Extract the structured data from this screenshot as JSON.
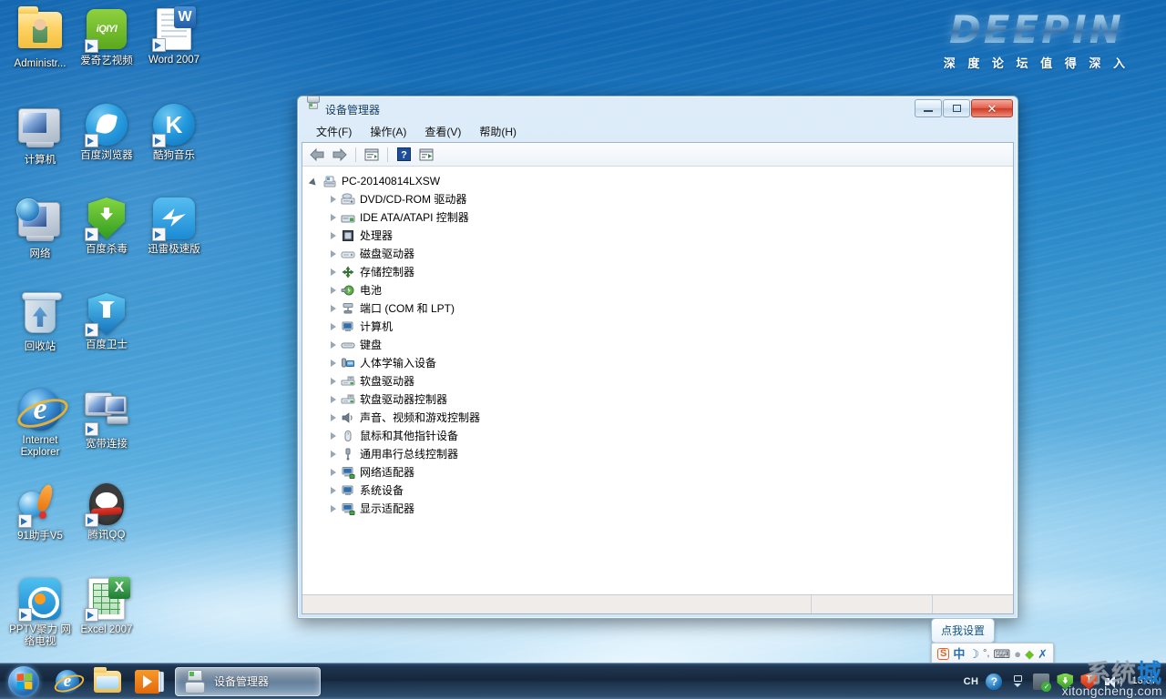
{
  "desktop": {
    "logo": {
      "word": "DEEPIN",
      "tagline": "深 度 论 坛   值 得 深 入"
    },
    "icons": [
      {
        "label": "Administr...",
        "icon": "user-folder-icon",
        "shortcut": false,
        "col": 0,
        "row": 0
      },
      {
        "label": "爱奇艺视频",
        "icon": "iqiyi-icon",
        "shortcut": true,
        "col": 1,
        "row": 0
      },
      {
        "label": "Word 2007",
        "icon": "word-icon",
        "shortcut": true,
        "col": 2,
        "row": 0
      },
      {
        "label": "计算机",
        "icon": "computer-icon",
        "shortcut": false,
        "col": 0,
        "row": 1
      },
      {
        "label": "百度浏览器",
        "icon": "baidu-browser-icon",
        "shortcut": true,
        "col": 1,
        "row": 1
      },
      {
        "label": "酷狗音乐",
        "icon": "kugou-music-icon",
        "shortcut": true,
        "col": 2,
        "row": 1
      },
      {
        "label": "网络",
        "icon": "network-icon",
        "shortcut": false,
        "col": 0,
        "row": 2
      },
      {
        "label": "百度杀毒",
        "icon": "baidu-antivirus-icon",
        "shortcut": true,
        "col": 1,
        "row": 2
      },
      {
        "label": "迅雷极速版",
        "icon": "thunder-icon",
        "shortcut": true,
        "col": 2,
        "row": 2
      },
      {
        "label": "回收站",
        "icon": "recycle-bin-icon",
        "shortcut": false,
        "col": 0,
        "row": 3
      },
      {
        "label": "百度卫士",
        "icon": "baidu-guard-icon",
        "shortcut": true,
        "col": 1,
        "row": 3
      },
      {
        "label": "Internet Explorer",
        "icon": "internet-explorer-icon",
        "shortcut": false,
        "col": 0,
        "row": 4
      },
      {
        "label": "宽带连接",
        "icon": "broadband-connection-icon",
        "shortcut": true,
        "col": 1,
        "row": 4
      },
      {
        "label": "91助手V5",
        "icon": "assistant91-icon",
        "shortcut": true,
        "col": 0,
        "row": 5
      },
      {
        "label": "腾讯QQ",
        "icon": "tencent-qq-icon",
        "shortcut": true,
        "col": 1,
        "row": 5
      },
      {
        "label": "PPTV聚力 网络电视",
        "icon": "pptv-icon",
        "shortcut": true,
        "col": 0,
        "row": 6
      },
      {
        "label": "Excel 2007",
        "icon": "excel-icon",
        "shortcut": true,
        "col": 1,
        "row": 6
      }
    ]
  },
  "window": {
    "title": "设备管理器",
    "icon": "device-manager-icon",
    "caption_buttons": {
      "minimize": "minimize-button",
      "maximize": "maximize-button",
      "close": "close-button"
    },
    "menu": [
      {
        "label": "文件(F)"
      },
      {
        "label": "操作(A)"
      },
      {
        "label": "查看(V)"
      },
      {
        "label": "帮助(H)"
      }
    ],
    "toolbar": [
      {
        "name": "back-icon"
      },
      {
        "name": "forward-icon"
      },
      {
        "name": "separator"
      },
      {
        "name": "properties-icon"
      },
      {
        "name": "separator"
      },
      {
        "name": "help-icon"
      },
      {
        "name": "scan-hardware-icon"
      }
    ],
    "tree": {
      "root": {
        "label": "PC-20140814LXSW",
        "icon": "computer-node-icon",
        "expanded": true
      },
      "children": [
        {
          "label": "DVD/CD-ROM 驱动器",
          "icon": "dvd-drive-icon"
        },
        {
          "label": "IDE ATA/ATAPI 控制器",
          "icon": "ide-controller-icon"
        },
        {
          "label": "处理器",
          "icon": "processor-icon"
        },
        {
          "label": "磁盘驱动器",
          "icon": "disk-drive-icon"
        },
        {
          "label": "存储控制器",
          "icon": "storage-controller-icon"
        },
        {
          "label": "电池",
          "icon": "battery-icon"
        },
        {
          "label": "端口 (COM 和 LPT)",
          "icon": "ports-icon"
        },
        {
          "label": "计算机",
          "icon": "computer-icon"
        },
        {
          "label": "键盘",
          "icon": "keyboard-icon"
        },
        {
          "label": "人体学输入设备",
          "icon": "hid-icon"
        },
        {
          "label": "软盘驱动器",
          "icon": "floppy-drive-icon"
        },
        {
          "label": "软盘驱动器控制器",
          "icon": "floppy-controller-icon"
        },
        {
          "label": "声音、视频和游戏控制器",
          "icon": "sound-video-game-icon"
        },
        {
          "label": "鼠标和其他指针设备",
          "icon": "mouse-icon"
        },
        {
          "label": "通用串行总线控制器",
          "icon": "usb-controller-icon"
        },
        {
          "label": "网络适配器",
          "icon": "network-adapter-icon"
        },
        {
          "label": "系统设备",
          "icon": "system-device-icon"
        },
        {
          "label": "显示适配器",
          "icon": "display-adapter-icon"
        }
      ]
    },
    "status_bar": {
      "panel1": "",
      "panel2": "",
      "panel3": ""
    }
  },
  "click_me_button": {
    "label": "点我设置"
  },
  "ime_bar": {
    "items": [
      {
        "name": "sogou-logo-icon",
        "glyph": "S"
      },
      {
        "name": "chinese-mode-icon",
        "glyph": "中"
      },
      {
        "name": "moon-icon",
        "glyph": "☽"
      },
      {
        "name": "punctuation-icon",
        "glyph": "°,"
      },
      {
        "name": "soft-keyboard-icon",
        "glyph": "⌨"
      },
      {
        "name": "user-icon",
        "glyph": "👤"
      },
      {
        "name": "toolbox-icon",
        "glyph": "◆"
      },
      {
        "name": "settings-wrench-icon",
        "glyph": "🔧"
      }
    ]
  },
  "taskbar": {
    "start_button": "start-orb",
    "quick_launch": [
      {
        "name": "internet-explorer-icon"
      },
      {
        "name": "windows-explorer-icon"
      },
      {
        "name": "windows-media-player-icon"
      }
    ],
    "tasks": [
      {
        "label": "设备管理器",
        "icon": "device-manager-icon",
        "active": true
      }
    ],
    "tray": {
      "language_indicator": "CH",
      "icons": [
        {
          "name": "action-center-help-icon"
        },
        {
          "name": "show-hidden-icons-icon"
        },
        {
          "name": "antivirus-tray-icon"
        },
        {
          "name": "baidu-guard-tray-icon"
        },
        {
          "name": "thunder-tray-icon"
        },
        {
          "name": "volume-icon"
        }
      ],
      "clock": "13:07"
    }
  },
  "watermark": {
    "cn_part1": "系统",
    "cn_part2": "城",
    "url": "xitongcheng.com"
  }
}
